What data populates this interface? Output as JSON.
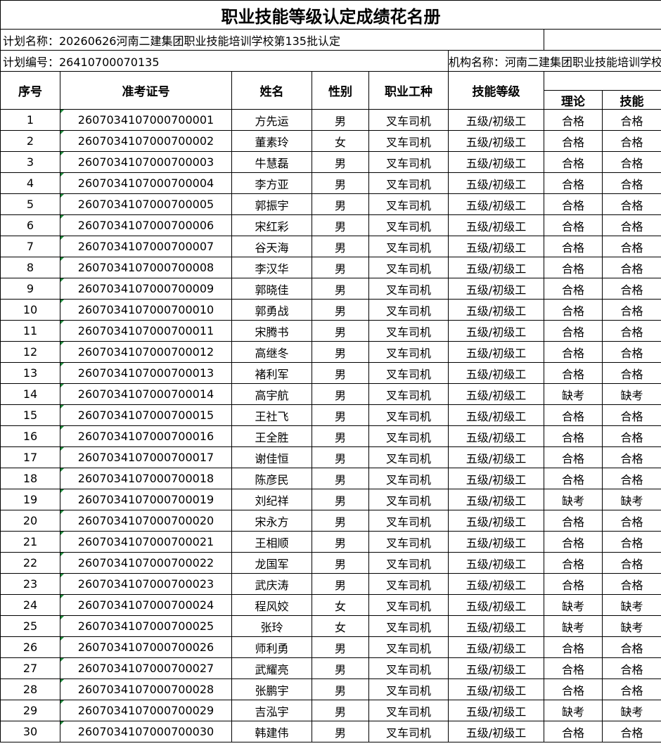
{
  "title": "职业技能等级认定成绩花名册",
  "plan_name": "计划名称：20260626河南二建集团职业技能培训学校第135批认定",
  "plan_number": "计划编号：26410700070135",
  "org_name": "机构名称：河南二建集团职业技能培训学校有限公司",
  "headers": {
    "seq": "序号",
    "exam_id": "准考证号",
    "name": "姓名",
    "gender": "性别",
    "occupation": "职业工种",
    "level": "技能等级",
    "theory": "理论",
    "skill": "技能"
  },
  "rows": [
    {
      "seq": "1",
      "exam_id": "2607034107000700001",
      "name": "方先运",
      "gender": "男",
      "occupation": "叉车司机",
      "level": "五级/初级工",
      "theory": "合格",
      "skill": "合格"
    },
    {
      "seq": "2",
      "exam_id": "2607034107000700002",
      "name": "董素玲",
      "gender": "女",
      "occupation": "叉车司机",
      "level": "五级/初级工",
      "theory": "合格",
      "skill": "合格"
    },
    {
      "seq": "3",
      "exam_id": "2607034107000700003",
      "name": "牛慧磊",
      "gender": "男",
      "occupation": "叉车司机",
      "level": "五级/初级工",
      "theory": "合格",
      "skill": "合格"
    },
    {
      "seq": "4",
      "exam_id": "2607034107000700004",
      "name": "李方亚",
      "gender": "男",
      "occupation": "叉车司机",
      "level": "五级/初级工",
      "theory": "合格",
      "skill": "合格"
    },
    {
      "seq": "5",
      "exam_id": "2607034107000700005",
      "name": "郭振宇",
      "gender": "男",
      "occupation": "叉车司机",
      "level": "五级/初级工",
      "theory": "合格",
      "skill": "合格"
    },
    {
      "seq": "6",
      "exam_id": "2607034107000700006",
      "name": "宋红彩",
      "gender": "男",
      "occupation": "叉车司机",
      "level": "五级/初级工",
      "theory": "合格",
      "skill": "合格"
    },
    {
      "seq": "7",
      "exam_id": "2607034107000700007",
      "name": "谷天海",
      "gender": "男",
      "occupation": "叉车司机",
      "level": "五级/初级工",
      "theory": "合格",
      "skill": "合格"
    },
    {
      "seq": "8",
      "exam_id": "2607034107000700008",
      "name": "李汉华",
      "gender": "男",
      "occupation": "叉车司机",
      "level": "五级/初级工",
      "theory": "合格",
      "skill": "合格"
    },
    {
      "seq": "9",
      "exam_id": "2607034107000700009",
      "name": "郭晓佳",
      "gender": "男",
      "occupation": "叉车司机",
      "level": "五级/初级工",
      "theory": "合格",
      "skill": "合格"
    },
    {
      "seq": "10",
      "exam_id": "2607034107000700010",
      "name": "郭勇战",
      "gender": "男",
      "occupation": "叉车司机",
      "level": "五级/初级工",
      "theory": "合格",
      "skill": "合格"
    },
    {
      "seq": "11",
      "exam_id": "2607034107000700011",
      "name": "宋腾书",
      "gender": "男",
      "occupation": "叉车司机",
      "level": "五级/初级工",
      "theory": "合格",
      "skill": "合格"
    },
    {
      "seq": "12",
      "exam_id": "2607034107000700012",
      "name": "高继冬",
      "gender": "男",
      "occupation": "叉车司机",
      "level": "五级/初级工",
      "theory": "合格",
      "skill": "合格"
    },
    {
      "seq": "13",
      "exam_id": "2607034107000700013",
      "name": "褚利军",
      "gender": "男",
      "occupation": "叉车司机",
      "level": "五级/初级工",
      "theory": "合格",
      "skill": "合格"
    },
    {
      "seq": "14",
      "exam_id": "2607034107000700014",
      "name": "高宇航",
      "gender": "男",
      "occupation": "叉车司机",
      "level": "五级/初级工",
      "theory": "缺考",
      "skill": "缺考"
    },
    {
      "seq": "15",
      "exam_id": "2607034107000700015",
      "name": "王社飞",
      "gender": "男",
      "occupation": "叉车司机",
      "level": "五级/初级工",
      "theory": "合格",
      "skill": "合格"
    },
    {
      "seq": "16",
      "exam_id": "2607034107000700016",
      "name": "王全胜",
      "gender": "男",
      "occupation": "叉车司机",
      "level": "五级/初级工",
      "theory": "合格",
      "skill": "合格"
    },
    {
      "seq": "17",
      "exam_id": "2607034107000700017",
      "name": "谢佳恒",
      "gender": "男",
      "occupation": "叉车司机",
      "level": "五级/初级工",
      "theory": "合格",
      "skill": "合格"
    },
    {
      "seq": "18",
      "exam_id": "2607034107000700018",
      "name": "陈彦民",
      "gender": "男",
      "occupation": "叉车司机",
      "level": "五级/初级工",
      "theory": "合格",
      "skill": "合格"
    },
    {
      "seq": "19",
      "exam_id": "2607034107000700019",
      "name": "刘纪祥",
      "gender": "男",
      "occupation": "叉车司机",
      "level": "五级/初级工",
      "theory": "缺考",
      "skill": "缺考"
    },
    {
      "seq": "20",
      "exam_id": "2607034107000700020",
      "name": "宋永方",
      "gender": "男",
      "occupation": "叉车司机",
      "level": "五级/初级工",
      "theory": "合格",
      "skill": "合格"
    },
    {
      "seq": "21",
      "exam_id": "2607034107000700021",
      "name": "王相顺",
      "gender": "男",
      "occupation": "叉车司机",
      "level": "五级/初级工",
      "theory": "合格",
      "skill": "合格"
    },
    {
      "seq": "22",
      "exam_id": "2607034107000700022",
      "name": "龙国军",
      "gender": "男",
      "occupation": "叉车司机",
      "level": "五级/初级工",
      "theory": "合格",
      "skill": "合格"
    },
    {
      "seq": "23",
      "exam_id": "2607034107000700023",
      "name": "武庆涛",
      "gender": "男",
      "occupation": "叉车司机",
      "level": "五级/初级工",
      "theory": "合格",
      "skill": "合格"
    },
    {
      "seq": "24",
      "exam_id": "2607034107000700024",
      "name": "程风姣",
      "gender": "女",
      "occupation": "叉车司机",
      "level": "五级/初级工",
      "theory": "缺考",
      "skill": "缺考"
    },
    {
      "seq": "25",
      "exam_id": "2607034107000700025",
      "name": "张玲",
      "gender": "女",
      "occupation": "叉车司机",
      "level": "五级/初级工",
      "theory": "缺考",
      "skill": "缺考"
    },
    {
      "seq": "26",
      "exam_id": "2607034107000700026",
      "name": "师利勇",
      "gender": "男",
      "occupation": "叉车司机",
      "level": "五级/初级工",
      "theory": "合格",
      "skill": "合格"
    },
    {
      "seq": "27",
      "exam_id": "2607034107000700027",
      "name": "武耀亮",
      "gender": "男",
      "occupation": "叉车司机",
      "level": "五级/初级工",
      "theory": "合格",
      "skill": "合格"
    },
    {
      "seq": "28",
      "exam_id": "2607034107000700028",
      "name": "张鹏宇",
      "gender": "男",
      "occupation": "叉车司机",
      "level": "五级/初级工",
      "theory": "合格",
      "skill": "合格"
    },
    {
      "seq": "29",
      "exam_id": "2607034107000700029",
      "name": "吉泓宇",
      "gender": "男",
      "occupation": "叉车司机",
      "level": "五级/初级工",
      "theory": "缺考",
      "skill": "缺考"
    },
    {
      "seq": "30",
      "exam_id": "2607034107000700030",
      "name": "韩建伟",
      "gender": "男",
      "occupation": "叉车司机",
      "level": "五级/初级工",
      "theory": "合格",
      "skill": "合格"
    }
  ]
}
